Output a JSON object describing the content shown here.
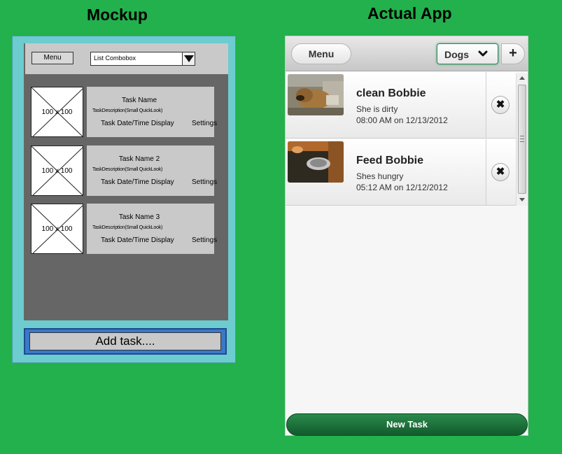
{
  "headings": {
    "mockup": "Mockup",
    "actual": "Actual App"
  },
  "mockup": {
    "menu_label": "Menu",
    "combo_label": "List Combobox",
    "thumb_label": "100 x 100",
    "tasks": [
      {
        "name": "Task Name",
        "desc": "TaskDescription(Small QuickLook)",
        "date": "Task Date/Time Display",
        "settings": "Settings"
      },
      {
        "name": "Task Name 2",
        "desc": "TaskDescription(Small QuickLook)",
        "date": "Task Date/Time Display",
        "settings": "Settings"
      },
      {
        "name": "Task Name 3",
        "desc": "TaskDescription(Small QuickLook)",
        "date": "Task Date/Time Display",
        "settings": "Settings"
      }
    ],
    "add_label": "Add task...."
  },
  "app": {
    "menu_label": "Menu",
    "select_value": "Dogs",
    "add_glyph": "+",
    "delete_glyph": "✖",
    "tasks": [
      {
        "title": "clean Bobbie",
        "desc": "She is dirty",
        "time": "08:00 AM on 12/13/2012",
        "photo_icon": "dog-on-couch-photo"
      },
      {
        "title": "Feed Bobbie",
        "desc": "Shes hungry",
        "time": "05:12 AM on 12/12/2012",
        "photo_icon": "dog-bowl-photo"
      }
    ],
    "new_task_label": "New Task"
  },
  "colors": {
    "background": "#22b14c",
    "mockup_frame": "#6ccccf",
    "footer_green": "#1e7a3f"
  }
}
